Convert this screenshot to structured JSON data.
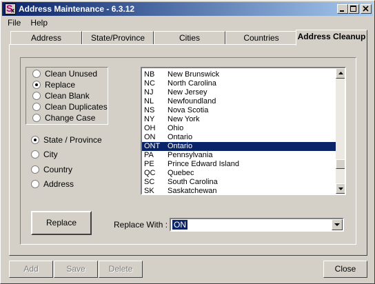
{
  "window": {
    "title": "Address Maintenance - 6.3.12"
  },
  "menu": [
    "File",
    "Help"
  ],
  "tabs": [
    "Address",
    "State/Province",
    "Cities",
    "Countries",
    "Address Cleanup"
  ],
  "cleanup_options": {
    "selected": "Replace",
    "items": [
      "Clean Unused",
      "Replace",
      "Clean Blank",
      "Clean Duplicates",
      "Change Case"
    ]
  },
  "target_options": {
    "selected": "State / Province",
    "items": [
      "State / Province",
      "City",
      "Country",
      "Address"
    ]
  },
  "list": {
    "selected_index": 8,
    "rows": [
      {
        "code": "NB",
        "name": "New Brunswick"
      },
      {
        "code": "NC",
        "name": "North Carolina"
      },
      {
        "code": "NJ",
        "name": "New Jersey"
      },
      {
        "code": "NL",
        "name": "Newfoundland"
      },
      {
        "code": "NS",
        "name": "Nova Scotia"
      },
      {
        "code": "NY",
        "name": "New York"
      },
      {
        "code": "OH",
        "name": "Ohio"
      },
      {
        "code": "ON",
        "name": "Ontario"
      },
      {
        "code": "ONT",
        "name": "Ontario"
      },
      {
        "code": "PA",
        "name": "Pennsylvania"
      },
      {
        "code": "PE",
        "name": "Prince Edward Island"
      },
      {
        "code": "QC",
        "name": "Quebec"
      },
      {
        "code": "SC",
        "name": "South Carolina"
      },
      {
        "code": "SK",
        "name": "Saskatchewan"
      }
    ]
  },
  "replace_button": "Replace",
  "replace_with": {
    "label": "Replace With :",
    "value": "ON"
  },
  "footer_buttons": {
    "add": "Add",
    "save": "Save",
    "delete": "Delete",
    "close": "Close"
  }
}
